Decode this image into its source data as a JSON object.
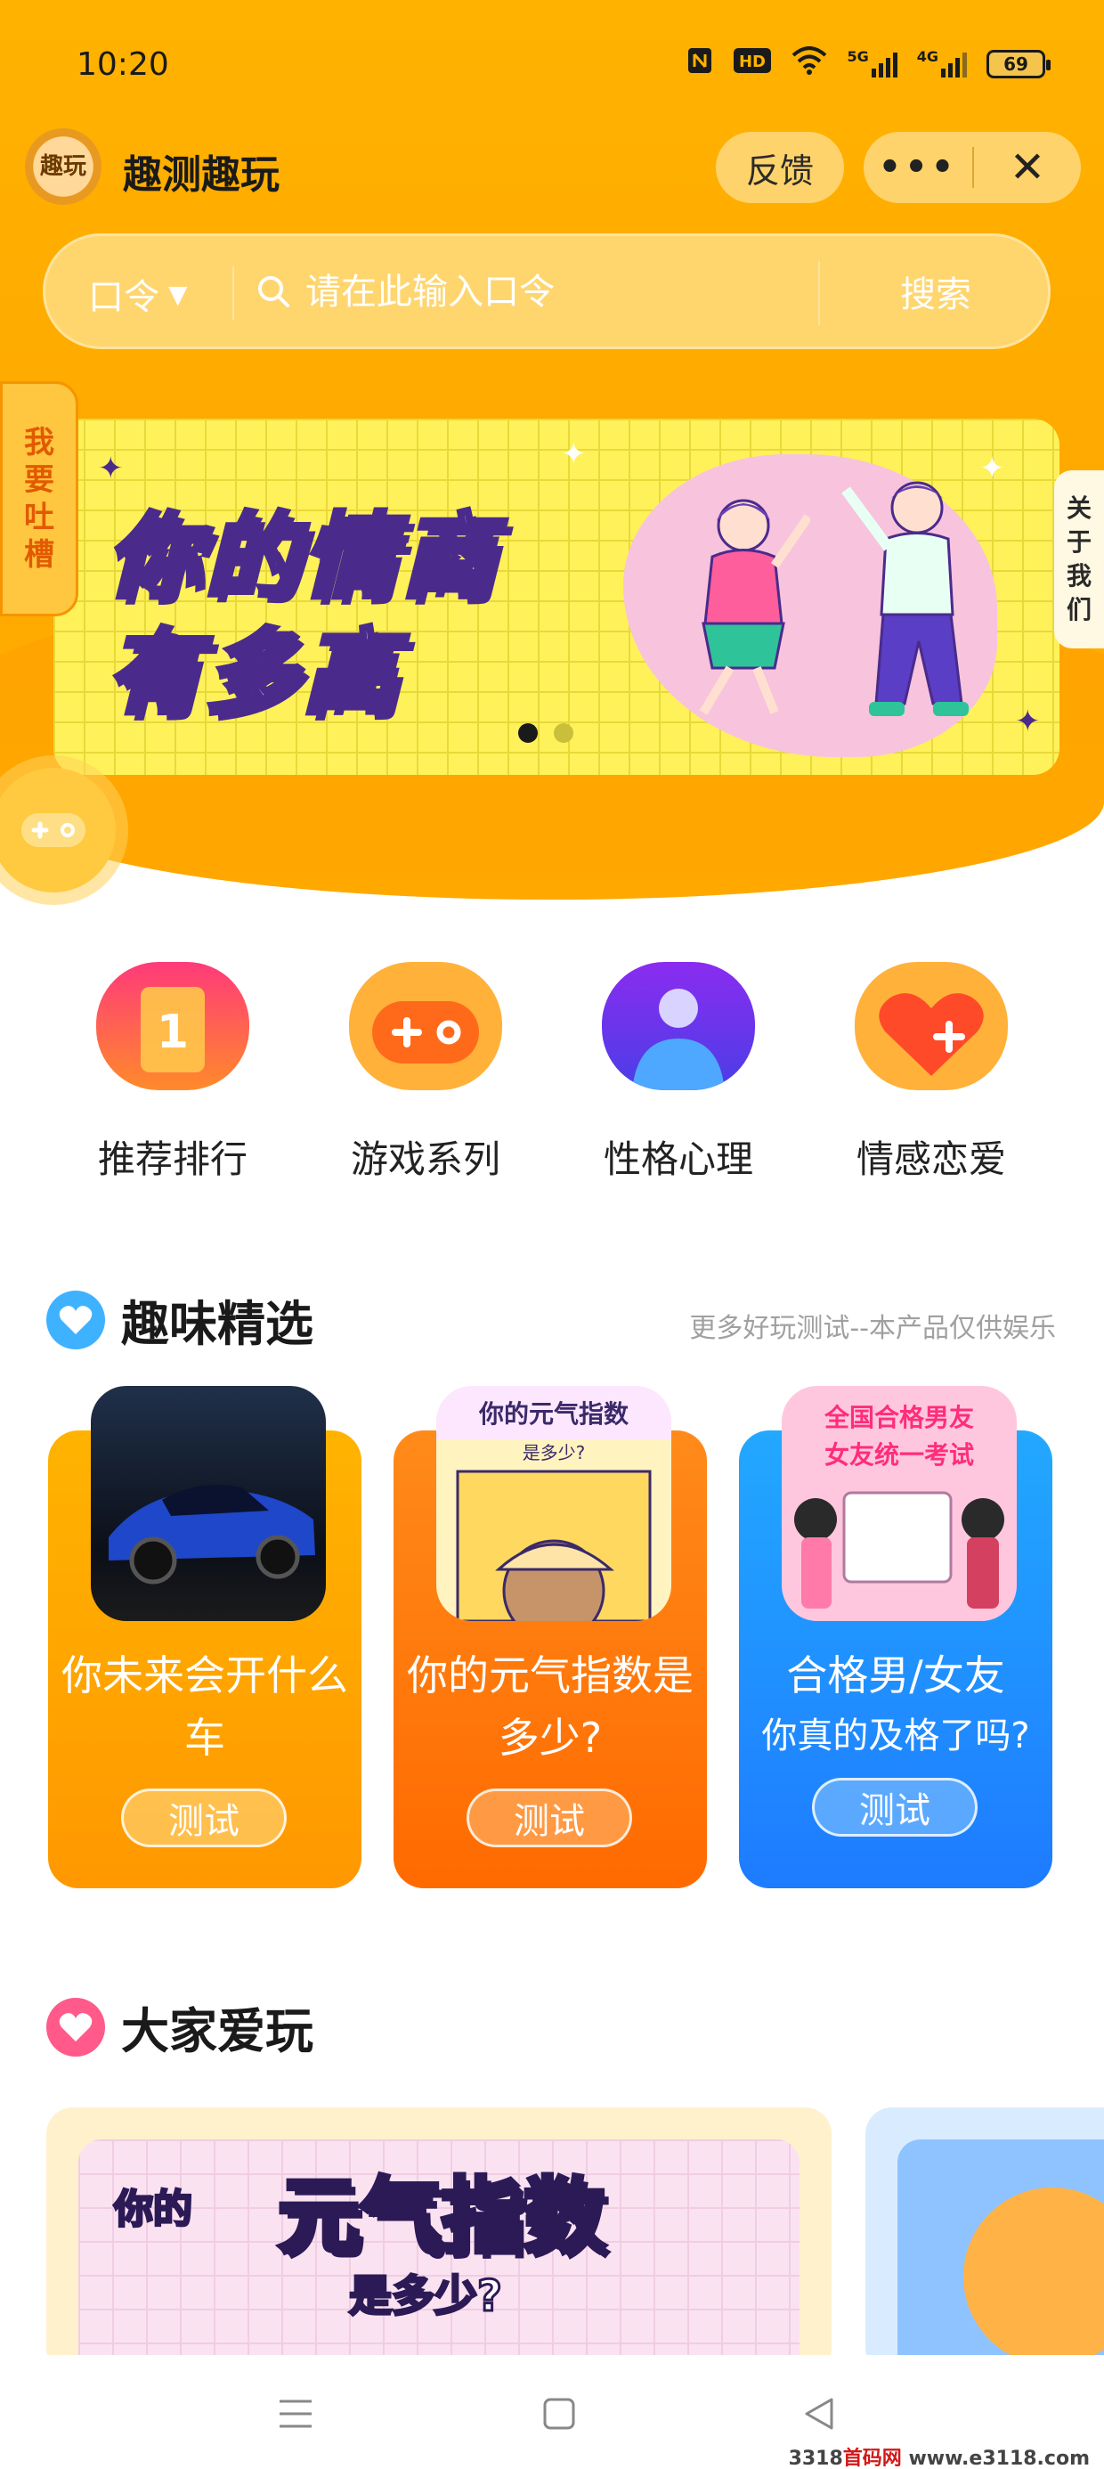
{
  "status_bar": {
    "time": "10:20",
    "icons": [
      "nfc-icon",
      "hd-icon",
      "wifi-icon",
      "5g-signal-icon",
      "4g-signal-icon"
    ],
    "hd_label": "HD",
    "sig5": "5G",
    "sig4": "4G",
    "battery": "69"
  },
  "app_bar": {
    "logo_text": "趣玩",
    "title": "趣测趣玩",
    "feedback": "反馈",
    "more": "•••",
    "close": "✕"
  },
  "search": {
    "keyword_type": "口令",
    "placeholder": "请在此输入口令",
    "button": "搜索"
  },
  "banner": {
    "line1": "你的情商",
    "line2": "有多高",
    "slides": 2,
    "active_slide": 1
  },
  "side_tag": [
    "我",
    "要",
    "吐",
    "槽"
  ],
  "about_tag": [
    "关",
    "于",
    "我",
    "们"
  ],
  "categories": [
    {
      "label": "推荐排行",
      "badge": "1"
    },
    {
      "label": "游戏系列"
    },
    {
      "label": "性格心理"
    },
    {
      "label": "情感恋爱"
    }
  ],
  "featured": {
    "title": "趣味精选",
    "note": "更多好玩测试--本产品仅供娱乐",
    "cards": [
      {
        "title": "你未来会开什么车",
        "subtitle": "",
        "button": "测试",
        "colors": [
          "#ffb300",
          "#ff9800"
        ]
      },
      {
        "title": "你的元气指数是多少?",
        "subtitle": "",
        "button": "测试",
        "colors": [
          "#ff8a1a",
          "#ff6a00"
        ]
      },
      {
        "title": "合格男/女友",
        "subtitle": "你真的及格了吗?",
        "button": "测试",
        "colors": [
          "#22a8ff",
          "#1e7bff"
        ]
      }
    ],
    "thumb_texts": {
      "card2_top": "你的元气指数",
      "card2_sub": "是多少?",
      "card3_line1": "全国合格男友",
      "card3_line2": "女友统一考试"
    }
  },
  "popular": {
    "title": "大家爱玩",
    "card1": {
      "small1": "你的",
      "big": "元气指数",
      "small2": "是多少?"
    }
  },
  "navbar": {
    "items": [
      "menu-icon",
      "home-icon",
      "back-icon"
    ]
  },
  "watermark": {
    "text1": "3318",
    "text2": "首码网",
    "text3": "www.e3118.com"
  }
}
